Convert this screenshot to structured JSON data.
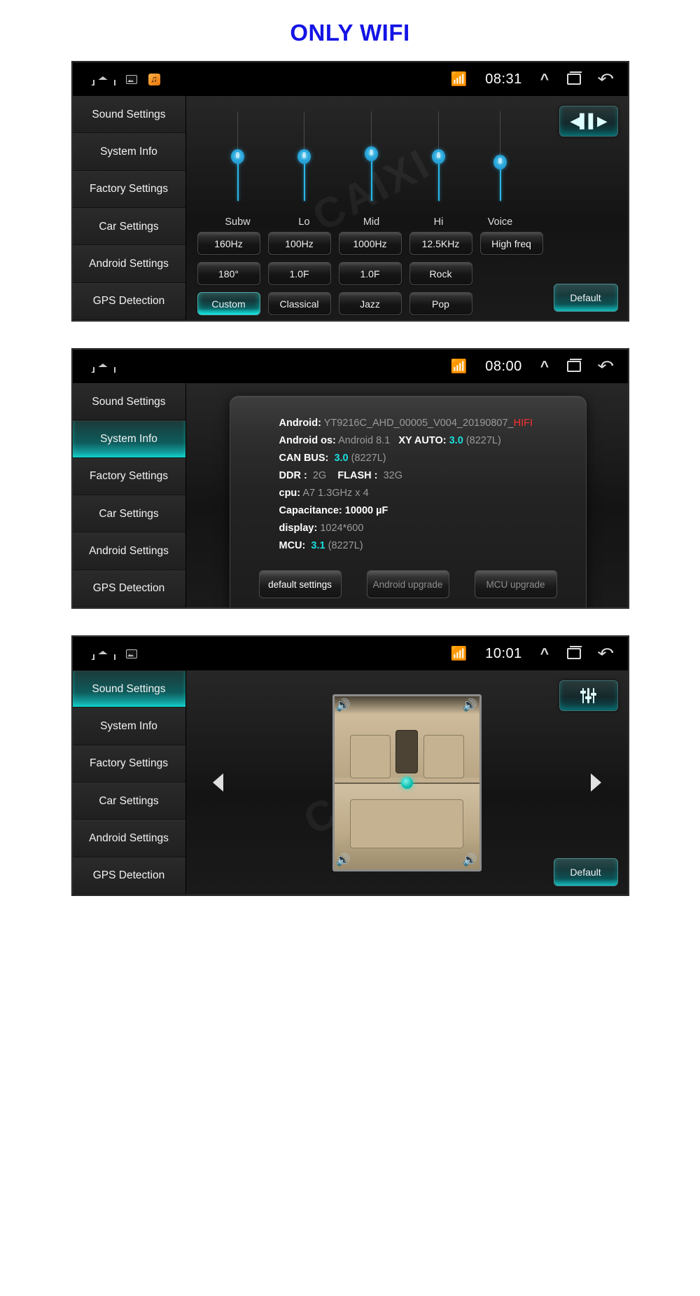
{
  "title": "ONLY WIFI",
  "watermark": "CAIXI",
  "sidebar": {
    "items": [
      {
        "label": "Sound Settings"
      },
      {
        "label": "System Info"
      },
      {
        "label": "Factory Settings"
      },
      {
        "label": "Car Settings"
      },
      {
        "label": "Android Settings"
      },
      {
        "label": "GPS Detection"
      }
    ]
  },
  "panel1": {
    "statusbar": {
      "home_icon": "home-icon",
      "screenshot_icon": "screenshot-icon",
      "music_icon": "music-note-icon",
      "bluetooth_icon": "bluetooth-icon",
      "time": "08:31",
      "chevron_icon": "chevron-up-icon",
      "recents_icon": "recents-icon",
      "back_icon": "back-icon"
    },
    "active_sidebar_index": -1,
    "balance_button": "balance-button",
    "eq": {
      "bands": [
        {
          "label": "Subw",
          "value": 50
        },
        {
          "label": "Lo",
          "value": 50
        },
        {
          "label": "Mid",
          "value": 52
        },
        {
          "label": "Hi",
          "value": 50
        },
        {
          "label": "Voice",
          "value": 45
        }
      ]
    },
    "row1": [
      "160Hz",
      "100Hz",
      "1000Hz",
      "12.5KHz",
      "High freq"
    ],
    "row2": [
      "180°",
      "1.0F",
      "1.0F",
      "Rock"
    ],
    "row3": [
      "Custom",
      "Classical",
      "Jazz",
      "Pop"
    ],
    "row3_selected": "Custom",
    "default_label": "Default"
  },
  "panel2": {
    "statusbar": {
      "time": "08:00"
    },
    "active_sidebar_index": 1,
    "info": [
      {
        "key": "Android:",
        "value": "YT9216C_AHD_00005_V004_20190807_",
        "suffix": "HIFI",
        "suffix_style": "red"
      },
      {
        "key": "Android os:",
        "value": "Android 8.1",
        "key2": "XY AUTO:",
        "value2": "3.0",
        "value2_style": "cyan",
        "value3": "(8227L)"
      },
      {
        "key": "CAN BUS:",
        "value": "3.0",
        "value_style": "cyan",
        "value3": "(8227L)"
      },
      {
        "key": "DDR :",
        "value": "2G",
        "key2": "FLASH :",
        "value2": "32G"
      },
      {
        "key": "cpu:",
        "value": "A7 1.3GHz x 4"
      },
      {
        "key": "Capacitance:",
        "value": "10000 µF",
        "value_style": "white"
      },
      {
        "key": "display:",
        "value": "1024*600"
      },
      {
        "key": "MCU:",
        "value": "3.1",
        "value_style": "cyan",
        "value3": "(8227L)"
      }
    ],
    "buttons": [
      {
        "label": "default settings",
        "dim": false
      },
      {
        "label": "Android upgrade",
        "dim": true
      },
      {
        "label": "MCU upgrade",
        "dim": true
      }
    ]
  },
  "panel3": {
    "statusbar": {
      "time": "10:01"
    },
    "active_sidebar_index": 0,
    "eq_button": "equalizer-button",
    "default_label": "Default",
    "arrows": [
      "up-arrow",
      "down-arrow",
      "left-arrow",
      "right-arrow"
    ],
    "speakers": [
      "speaker-front-left",
      "speaker-front-right",
      "speaker-rear-left",
      "speaker-rear-right"
    ],
    "center": "balance-center-dot"
  },
  "colors": {
    "title": "#1414e6",
    "accent_cyan": "#19dede",
    "slider_blue": "#29b6e8",
    "red": "#ff2f2f"
  }
}
